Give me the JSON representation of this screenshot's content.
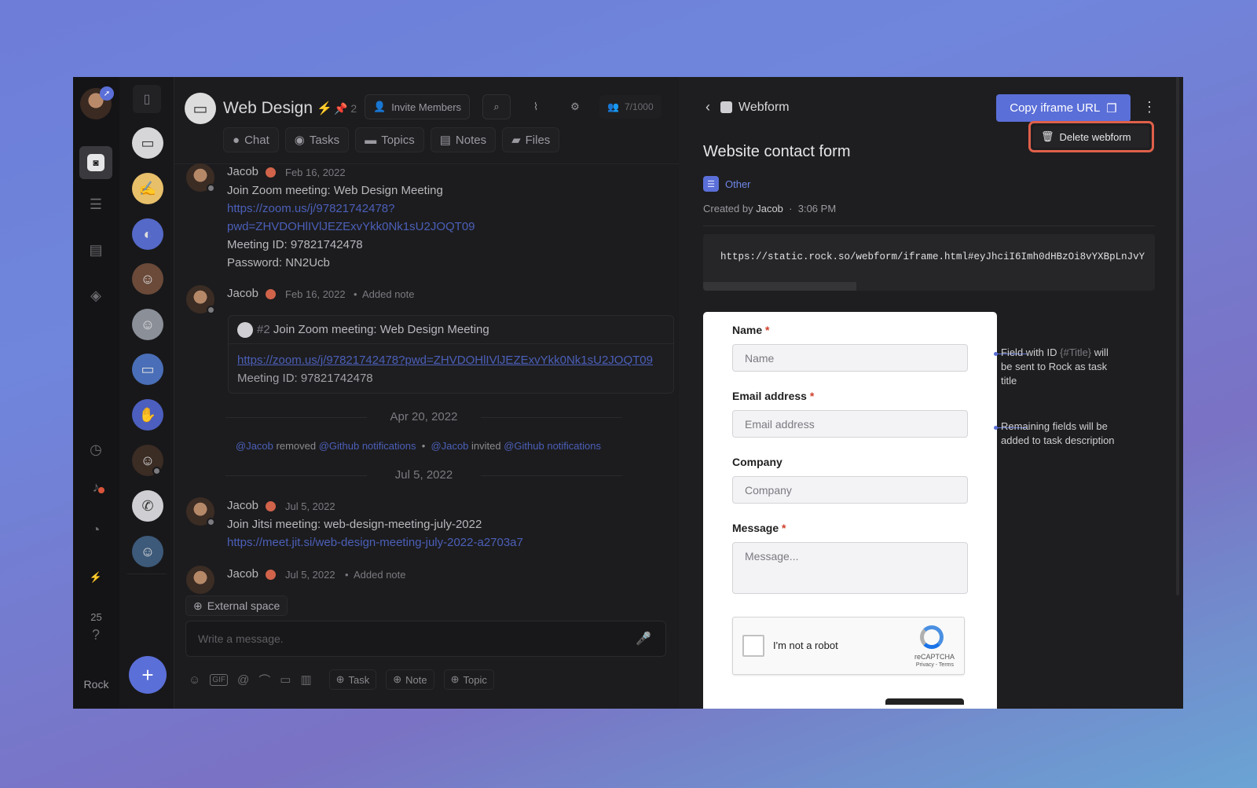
{
  "rail": {
    "counter": "25",
    "brand": "Rock"
  },
  "chat": {
    "title": "Web Design",
    "pin_count": "2",
    "invite_label": "Invite Members",
    "members": "7/1000",
    "tabs": [
      {
        "label": "Chat"
      },
      {
        "label": "Tasks"
      },
      {
        "label": "Topics"
      },
      {
        "label": "Notes"
      },
      {
        "label": "Files"
      }
    ],
    "messages": [
      {
        "author": "Jacob",
        "date": "Feb 16, 2022",
        "lines": [
          "Join Zoom meeting: Web Design Meeting",
          "https://zoom.us/j/97821742478?",
          "pwd=ZHVDOHlIVlJEZExvYkk0Nk1sU2JOQT09",
          "Meeting ID: 97821742478",
          "Password: NN2Ucb"
        ]
      },
      {
        "author": "Jacob",
        "date": "Feb 16, 2022",
        "action": "Added note",
        "quote": {
          "number": "#2",
          "title": "Join Zoom meeting: Web Design Meeting",
          "link": "https://zoom.us/j/97821742478?pwd=ZHVDOHlIVlJEZExvYkk0Nk1sU2JOQT09",
          "meta": "Meeting ID: 97821742478"
        }
      },
      {
        "author": "Jacob",
        "date": "Jul 5, 2022",
        "lines": [
          "Join Jitsi meeting: web-design-meeting-july-2022",
          "https://meet.jit.si/web-design-meeting-july-2022-a2703a7"
        ]
      },
      {
        "author": "Jacob",
        "date": "Jul 5, 2022",
        "action": "Added note"
      }
    ],
    "date_separators": [
      "Apr 20, 2022",
      "Jul 5, 2022"
    ],
    "system": {
      "actor1": "@Jacob",
      "verb1": "removed",
      "target1": "@Github notifications",
      "actor2": "@Jacob",
      "verb2": "invited",
      "target2": "@Github notifications"
    },
    "external_label": "External space",
    "composer_placeholder": "Write a message.",
    "chips": [
      {
        "label": "Task"
      },
      {
        "label": "Note"
      },
      {
        "label": "Topic"
      }
    ]
  },
  "panel": {
    "breadcrumb": "Webform",
    "copy_label": "Copy iframe URL",
    "menu_item": "Delete webform",
    "title": "Website contact form",
    "category": "Other",
    "created_prefix": "Created by",
    "created_by": "Jacob",
    "created_time": "3:06 PM",
    "iframe_url": "https://static.rock.so/webform/iframe.html#eyJhciI6Imh0dHBzOi8vYXBpLnJvY",
    "form": {
      "fields": [
        {
          "label": "Name",
          "required": "*",
          "placeholder": "Name"
        },
        {
          "label": "Email address",
          "required": "*",
          "placeholder": "Email address"
        },
        {
          "label": "Company",
          "required": "",
          "placeholder": "Company"
        },
        {
          "label": "Message",
          "required": "*",
          "placeholder": "Message..."
        }
      ],
      "captcha_label": "I'm not a robot",
      "captcha_brand": "reCAPTCHA",
      "captcha_links": "Privacy - Terms"
    },
    "notes": {
      "title_note_pre": "Field with ID",
      "title_note_id": "{#Title}",
      "title_note_post": "will be sent to Rock as task title",
      "desc_note": "Remaining fields will be added to task description"
    }
  }
}
